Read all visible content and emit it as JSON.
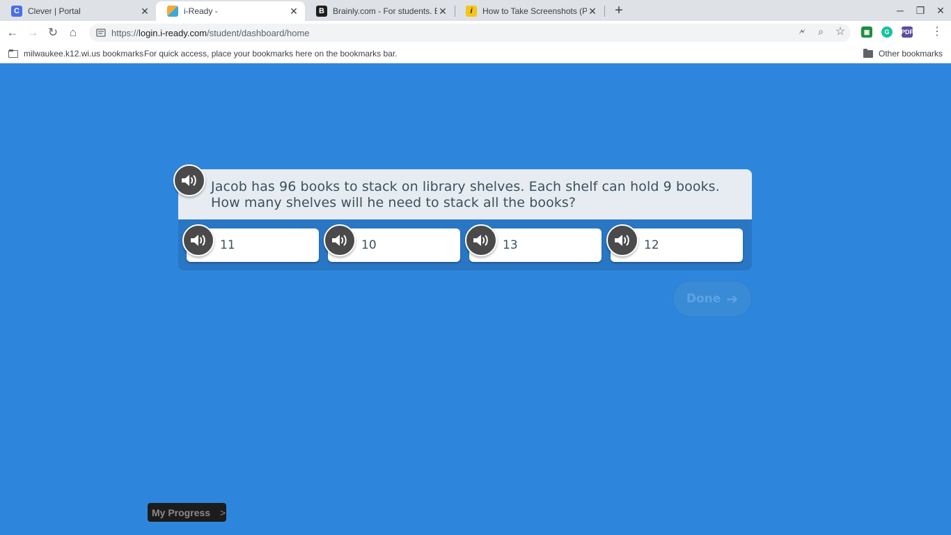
{
  "browser": {
    "tabs": [
      {
        "title": "Clever | Portal",
        "favicon": "C",
        "favicon_color": "#4b6de8",
        "active": false
      },
      {
        "title": "i-Ready -",
        "favicon": "",
        "favicon_color": "#f2a93b",
        "active": true
      },
      {
        "title": "Brainly.com - For students. By st",
        "favicon": "B",
        "favicon_color": "#1e1e1e",
        "active": false
      },
      {
        "title": "How to Take Screenshots (Print S",
        "favicon": "i",
        "favicon_color": "#f5c518",
        "active": false
      }
    ],
    "url": {
      "scheme": "https://",
      "host": "login.i-ready.com",
      "path": "/student/dashboard/home"
    },
    "bookmarks": {
      "folder": "milwaukee.k12.wi.us bookmarks",
      "hint": "For quick access, place your bookmarks here on the bookmarks bar.",
      "other": "Other bookmarks"
    }
  },
  "lesson": {
    "question": "Jacob has 96 books to stack on library shelves. Each shelf can hold 9 books. How many shelves will he need to stack all the books?",
    "answers": [
      "11",
      "10",
      "13",
      "12"
    ],
    "done_label": "Done",
    "progress_label": "My Progress",
    "progress_chevron": ">"
  },
  "colors": {
    "page_background": "#2e86dc",
    "question_background": "#e6ecf2",
    "answers_background": "#2976c4",
    "speaker_icon": "#4a4a4a"
  }
}
